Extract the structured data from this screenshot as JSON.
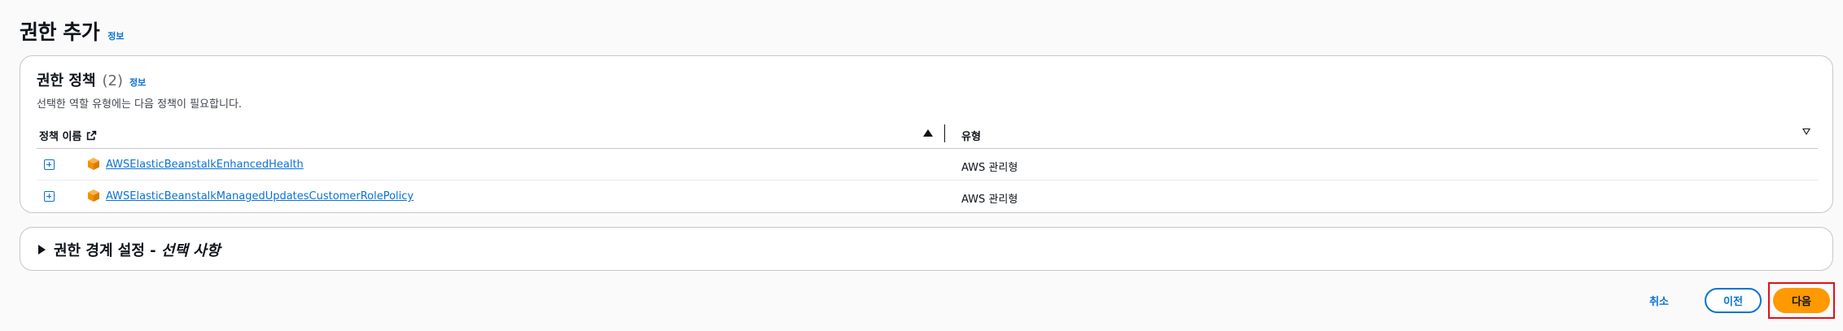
{
  "page": {
    "title": "권한 추가",
    "info_label": "정보"
  },
  "policies": {
    "title": "권한 정책",
    "count": "(2)",
    "info_label": "정보",
    "description": "선택한 역할 유형에는 다음 정책이 필요합니다.",
    "columns": {
      "name": "정책 이름",
      "type": "유형"
    },
    "rows": [
      {
        "name": "AWSElasticBeanstalkEnhancedHealth",
        "type": "AWS 관리형"
      },
      {
        "name": "AWSElasticBeanstalkManagedUpdatesCustomerRolePolicy",
        "type": "AWS 관리형"
      }
    ]
  },
  "boundary": {
    "title": "권한 경계 설정 - ",
    "optional": "선택 사항"
  },
  "actions": {
    "cancel": "취소",
    "previous": "이전",
    "next": "다음"
  },
  "colors": {
    "link": "#0972d3",
    "primary": "#ff9900",
    "highlight": "#e0101a",
    "icon_orange": "#f29100"
  }
}
